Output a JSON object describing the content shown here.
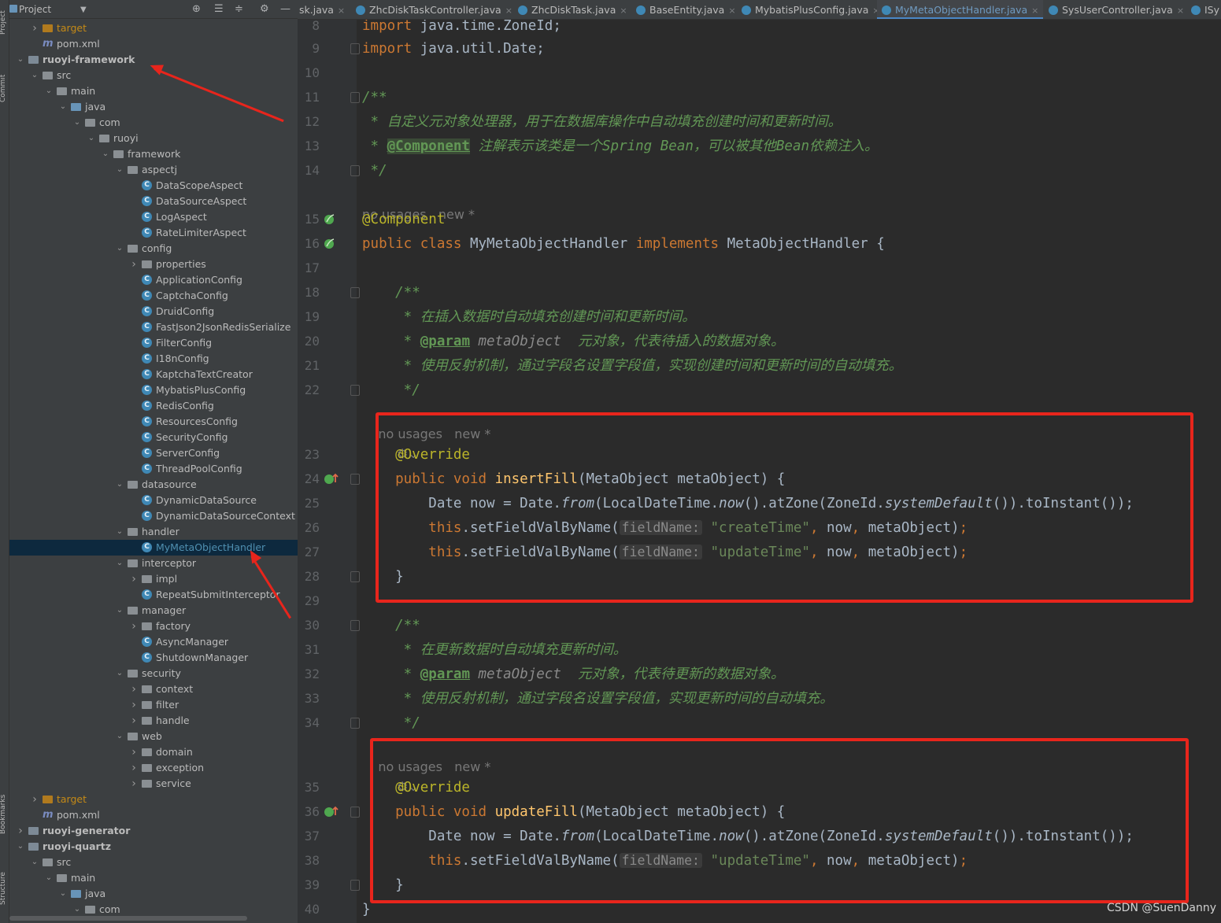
{
  "side_stripe": {
    "top": "Project",
    "middle": "Commit",
    "lower": "Bookmarks",
    "bottom": "Structure"
  },
  "project_panel": {
    "title": "Project",
    "tree": [
      {
        "label": "target",
        "kind": "folder-orange",
        "state": "collapsed",
        "style": "target"
      },
      {
        "label": "pom.xml",
        "kind": "maven"
      },
      {
        "label": "ruoyi-framework",
        "kind": "module",
        "state": "expanded",
        "style": "bold"
      },
      {
        "label": "src",
        "kind": "folder",
        "state": "expanded"
      },
      {
        "label": "main",
        "kind": "folder",
        "state": "expanded"
      },
      {
        "label": "java",
        "kind": "folder-blue",
        "state": "expanded"
      },
      {
        "label": "com",
        "kind": "folder",
        "state": "expanded"
      },
      {
        "label": "ruoyi",
        "kind": "folder",
        "state": "expanded"
      },
      {
        "label": "framework",
        "kind": "folder",
        "state": "expanded"
      },
      {
        "label": "aspectj",
        "kind": "folder",
        "state": "expanded"
      },
      {
        "label": "DataScopeAspect",
        "kind": "class"
      },
      {
        "label": "DataSourceAspect",
        "kind": "class"
      },
      {
        "label": "LogAspect",
        "kind": "class"
      },
      {
        "label": "RateLimiterAspect",
        "kind": "class"
      },
      {
        "label": "config",
        "kind": "folder",
        "state": "expanded"
      },
      {
        "label": "properties",
        "kind": "folder",
        "state": "collapsed"
      },
      {
        "label": "ApplicationConfig",
        "kind": "class"
      },
      {
        "label": "CaptchaConfig",
        "kind": "class"
      },
      {
        "label": "DruidConfig",
        "kind": "class"
      },
      {
        "label": "FastJson2JsonRedisSerialize",
        "kind": "class"
      },
      {
        "label": "FilterConfig",
        "kind": "class"
      },
      {
        "label": "I18nConfig",
        "kind": "class"
      },
      {
        "label": "KaptchaTextCreator",
        "kind": "class"
      },
      {
        "label": "MybatisPlusConfig",
        "kind": "class"
      },
      {
        "label": "RedisConfig",
        "kind": "class"
      },
      {
        "label": "ResourcesConfig",
        "kind": "class"
      },
      {
        "label": "SecurityConfig",
        "kind": "class"
      },
      {
        "label": "ServerConfig",
        "kind": "class"
      },
      {
        "label": "ThreadPoolConfig",
        "kind": "class"
      },
      {
        "label": "datasource",
        "kind": "folder",
        "state": "expanded"
      },
      {
        "label": "DynamicDataSource",
        "kind": "class"
      },
      {
        "label": "DynamicDataSourceContext",
        "kind": "class"
      },
      {
        "label": "handler",
        "kind": "folder",
        "state": "expanded"
      },
      {
        "label": "MyMetaObjectHandler",
        "kind": "class",
        "selected": true
      },
      {
        "label": "interceptor",
        "kind": "folder",
        "state": "expanded"
      },
      {
        "label": "impl",
        "kind": "folder",
        "state": "collapsed"
      },
      {
        "label": "RepeatSubmitInterceptor",
        "kind": "class"
      },
      {
        "label": "manager",
        "kind": "folder",
        "state": "expanded"
      },
      {
        "label": "factory",
        "kind": "folder",
        "state": "collapsed"
      },
      {
        "label": "AsyncManager",
        "kind": "class"
      },
      {
        "label": "ShutdownManager",
        "kind": "class"
      },
      {
        "label": "security",
        "kind": "folder",
        "state": "expanded"
      },
      {
        "label": "context",
        "kind": "folder",
        "state": "collapsed"
      },
      {
        "label": "filter",
        "kind": "folder",
        "state": "collapsed"
      },
      {
        "label": "handle",
        "kind": "folder",
        "state": "collapsed"
      },
      {
        "label": "web",
        "kind": "folder",
        "state": "expanded"
      },
      {
        "label": "domain",
        "kind": "folder",
        "state": "collapsed"
      },
      {
        "label": "exception",
        "kind": "folder",
        "state": "collapsed"
      },
      {
        "label": "service",
        "kind": "folder",
        "state": "collapsed"
      },
      {
        "label": "target",
        "kind": "folder-orange",
        "state": "collapsed",
        "style": "target"
      },
      {
        "label": "pom.xml",
        "kind": "maven"
      },
      {
        "label": "ruoyi-generator",
        "kind": "module",
        "state": "collapsed",
        "style": "bold"
      },
      {
        "label": "ruoyi-quartz",
        "kind": "module",
        "state": "expanded",
        "style": "bold"
      },
      {
        "label": "src",
        "kind": "folder",
        "state": "expanded"
      },
      {
        "label": "main",
        "kind": "folder",
        "state": "expanded"
      },
      {
        "label": "java",
        "kind": "folder-blue",
        "state": "expanded"
      },
      {
        "label": "com",
        "kind": "folder",
        "state": "expanded"
      }
    ]
  },
  "tabs": [
    {
      "label": "sk.java",
      "active": false
    },
    {
      "label": "ZhcDiskTaskController.java",
      "active": false
    },
    {
      "label": "ZhcDiskTask.java",
      "active": false
    },
    {
      "label": "BaseEntity.java",
      "active": false
    },
    {
      "label": "MybatisPlusConfig.java",
      "active": false
    },
    {
      "label": "MyMetaObjectHandler.java",
      "active": true
    },
    {
      "label": "SysUserController.java",
      "active": false
    },
    {
      "label": "ISy",
      "active": false
    }
  ],
  "code_lines": [
    {
      "n": "8",
      "segs": [
        [
          "kw",
          "import "
        ],
        [
          "",
          "java.time.ZoneId;"
        ]
      ]
    },
    {
      "n": "9",
      "segs": [
        [
          "kw",
          "import "
        ],
        [
          "",
          "java.util.Date;"
        ]
      ]
    },
    {
      "n": "10",
      "segs": []
    },
    {
      "n": "11",
      "segs": [
        [
          "cm",
          "/**"
        ]
      ]
    },
    {
      "n": "12",
      "segs": [
        [
          "cm",
          " * 自定义元对象处理器，用于在数据库操作中自动填充创建时间和更新时间。"
        ]
      ]
    },
    {
      "n": "13",
      "segs": [
        [
          "cm",
          " * "
        ],
        [
          "tgb",
          "@Component"
        ],
        [
          "cm",
          " 注解表示该类是一个Spring Bean，可以被其他Bean依赖注入。"
        ]
      ]
    },
    {
      "n": "14",
      "segs": [
        [
          "cm",
          " */"
        ]
      ]
    },
    {
      "n": "",
      "usage": "no usages   new *"
    },
    {
      "n": "15",
      "segs": [
        [
          "an",
          "@Component"
        ]
      ]
    },
    {
      "n": "16",
      "segs": [
        [
          "kw",
          "public class "
        ],
        [
          "",
          "MyMetaObjectHandler "
        ],
        [
          "kw",
          "implements "
        ],
        [
          "",
          "MetaObjectHandler {"
        ]
      ]
    },
    {
      "n": "17",
      "segs": []
    },
    {
      "n": "18",
      "segs": [
        [
          "cm",
          "    /**"
        ]
      ]
    },
    {
      "n": "19",
      "segs": [
        [
          "cm",
          "     * 在插入数据时自动填充创建时间和更新时间。"
        ]
      ]
    },
    {
      "n": "20",
      "segs": [
        [
          "cm",
          "     * "
        ],
        [
          "tg",
          "@param"
        ],
        [
          "pn",
          " metaObject"
        ],
        [
          "cm",
          "  元对象，代表待插入的数据对象。"
        ]
      ]
    },
    {
      "n": "21",
      "segs": [
        [
          "cm",
          "     * 使用反射机制，通过字段名设置字段值，实现创建时间和更新时间的自动填充。"
        ]
      ]
    },
    {
      "n": "22",
      "segs": [
        [
          "cm",
          "     */"
        ]
      ]
    },
    {
      "n": "",
      "usage": "    no usages   new *"
    },
    {
      "n": "",
      "icon": true
    },
    {
      "n": "23",
      "segs": [
        [
          "an",
          "    @Override"
        ]
      ]
    },
    {
      "n": "24",
      "segs": [
        [
          "kw",
          "    public void "
        ],
        [
          "mt",
          "insertFill"
        ],
        [
          "",
          "(MetaObject metaObject) {"
        ]
      ]
    },
    {
      "n": "25",
      "segs": [
        [
          "",
          "        Date now = Date."
        ],
        [
          "fn",
          "from"
        ],
        [
          "",
          "(LocalDateTime."
        ],
        [
          "fn",
          "now"
        ],
        [
          "",
          "().atZone(ZoneId."
        ],
        [
          "fn",
          "systemDefault"
        ],
        [
          "",
          "()).toInstant());"
        ]
      ]
    },
    {
      "n": "26",
      "segs": [
        [
          "kw",
          "        this"
        ],
        [
          "",
          ".setFieldValByName("
        ],
        [
          "hint",
          "fieldName:"
        ],
        [
          "st",
          " \"createTime\""
        ],
        [
          "kw",
          ", "
        ],
        [
          "",
          "now"
        ],
        [
          "kw",
          ", "
        ],
        [
          "",
          "metaObject)"
        ],
        [
          "kw",
          ";"
        ]
      ]
    },
    {
      "n": "27",
      "segs": [
        [
          "kw",
          "        this"
        ],
        [
          "",
          ".setFieldValByName("
        ],
        [
          "hint",
          "fieldName:"
        ],
        [
          "st",
          " \"updateTime\""
        ],
        [
          "kw",
          ", "
        ],
        [
          "",
          "now"
        ],
        [
          "kw",
          ", "
        ],
        [
          "",
          "metaObject)"
        ],
        [
          "kw",
          ";"
        ]
      ]
    },
    {
      "n": "28",
      "segs": [
        [
          "",
          "    }"
        ]
      ]
    },
    {
      "n": "29",
      "segs": []
    },
    {
      "n": "30",
      "segs": [
        [
          "cm",
          "    /**"
        ]
      ]
    },
    {
      "n": "31",
      "segs": [
        [
          "cm",
          "     * 在更新数据时自动填充更新时间。"
        ]
      ]
    },
    {
      "n": "32",
      "segs": [
        [
          "cm",
          "     * "
        ],
        [
          "tg",
          "@param"
        ],
        [
          "pn",
          " metaObject"
        ],
        [
          "cm",
          "  元对象，代表待更新的数据对象。"
        ]
      ]
    },
    {
      "n": "33",
      "segs": [
        [
          "cm",
          "     * 使用反射机制，通过字段名设置字段值，实现更新时间的自动填充。"
        ]
      ]
    },
    {
      "n": "34",
      "segs": [
        [
          "cm",
          "     */"
        ]
      ]
    },
    {
      "n": "",
      "usage": "    no usages   new *"
    },
    {
      "n": "",
      "icon": true
    },
    {
      "n": "35",
      "segs": [
        [
          "an",
          "    @Override"
        ]
      ]
    },
    {
      "n": "36",
      "segs": [
        [
          "kw",
          "    public void "
        ],
        [
          "mt",
          "updateFill"
        ],
        [
          "",
          "(MetaObject metaObject) {"
        ]
      ]
    },
    {
      "n": "37",
      "segs": [
        [
          "",
          "        Date now = Date."
        ],
        [
          "fn",
          "from"
        ],
        [
          "",
          "(LocalDateTime."
        ],
        [
          "fn",
          "now"
        ],
        [
          "",
          "().atZone(ZoneId."
        ],
        [
          "fn",
          "systemDefault"
        ],
        [
          "",
          "()).toInstant());"
        ]
      ]
    },
    {
      "n": "38",
      "segs": [
        [
          "kw",
          "        this"
        ],
        [
          "",
          ".setFieldValByName("
        ],
        [
          "hint",
          "fieldName:"
        ],
        [
          "st",
          " \"updateTime\""
        ],
        [
          "kw",
          ", "
        ],
        [
          "",
          "now"
        ],
        [
          "kw",
          ", "
        ],
        [
          "",
          "metaObject)"
        ],
        [
          "kw",
          ";"
        ]
      ]
    },
    {
      "n": "39",
      "segs": [
        [
          "",
          "    }"
        ]
      ]
    },
    {
      "n": "40",
      "segs": [
        [
          "",
          "}"
        ]
      ]
    }
  ],
  "watermark": "CSDN @SuenDanny",
  "colors": {
    "annotation": "#e8251c",
    "selection": "#0d293e",
    "keyword": "#cc7832",
    "comment": "#629755"
  }
}
